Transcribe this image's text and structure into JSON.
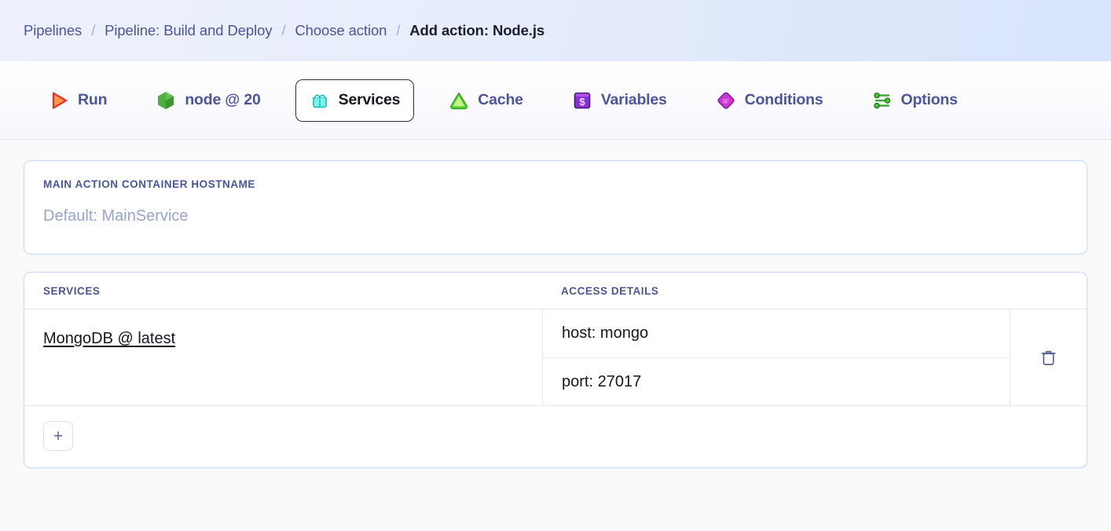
{
  "breadcrumb": {
    "separator": "/",
    "items": [
      {
        "label": "Pipelines",
        "current": false
      },
      {
        "label": "Pipeline: Build and Deploy",
        "current": false
      },
      {
        "label": "Choose action",
        "current": false
      },
      {
        "label": "Add action: Node.js",
        "current": true
      }
    ]
  },
  "tabs": [
    {
      "label": "Run",
      "icon": "play-icon",
      "active": false
    },
    {
      "label": "node @ 20",
      "icon": "hexagon-icon",
      "active": false
    },
    {
      "label": "Services",
      "icon": "container-icon",
      "active": true
    },
    {
      "label": "Cache",
      "icon": "triangle-icon",
      "active": false
    },
    {
      "label": "Variables",
      "icon": "dollar-box-icon",
      "active": false
    },
    {
      "label": "Conditions",
      "icon": "if-diamond-icon",
      "active": false
    },
    {
      "label": "Options",
      "icon": "sliders-icon",
      "active": false
    }
  ],
  "hostname": {
    "label": "MAIN ACTION CONTAINER HOSTNAME",
    "placeholder": "Default: MainService",
    "value": ""
  },
  "services_table": {
    "headers": {
      "services": "SERVICES",
      "access_details": "ACCESS DETAILS"
    },
    "rows": [
      {
        "name": "MongoDB @ latest",
        "access_details": [
          "host: mongo",
          "port: 27017"
        ],
        "delete_icon": "trash-icon"
      }
    ],
    "add_button_label": "+"
  },
  "colors": {
    "accent_blue": "#4a5697",
    "border_blue": "#c9daf6",
    "link_dark": "#15171f",
    "placeholder": "#97a4cb",
    "node_green": "#4caf3f",
    "cache_green": "#5fd63a",
    "variables_purple": "#8b2fd6",
    "conditions_magenta": "#cc35d6",
    "run_orange": "#f9813a",
    "run_red": "#e8332a",
    "services_cyan": "#5fe6e0"
  }
}
